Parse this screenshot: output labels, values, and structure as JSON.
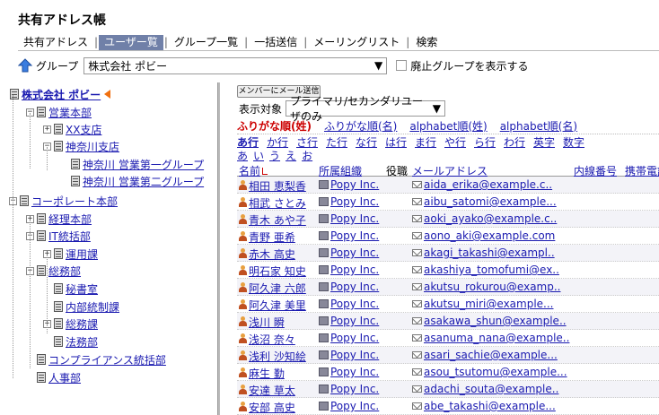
{
  "title": "共有アドレス帳",
  "tabs": [
    "共有アドレス",
    "ユーザー覧",
    "グループ一覧",
    "一括送信",
    "メーリングリスト",
    "検索"
  ],
  "active_tab": 1,
  "group_bar": {
    "label": "グループ",
    "selected": "株式会社 ポビー",
    "checkbox_label": "廃止グループを表示する"
  },
  "tree": [
    {
      "label": "株式会社 ポビー",
      "root": true
    },
    {
      "label": "営業本部",
      "toggle": "−"
    },
    {
      "label": "XX支店",
      "toggle": "+"
    },
    {
      "label": "神奈川支店",
      "toggle": "−"
    },
    {
      "label": "神奈川 営業第一グループ"
    },
    {
      "label": "神奈川 営業第二グループ"
    },
    {
      "label": "コーポレート本部",
      "toggle": "−"
    },
    {
      "label": "経理本部",
      "toggle": "+"
    },
    {
      "label": "IT統括部",
      "toggle": "−"
    },
    {
      "label": "運用課",
      "toggle": "+"
    },
    {
      "label": "総務部",
      "toggle": "−"
    },
    {
      "label": "秘書室"
    },
    {
      "label": "内部統制課"
    },
    {
      "label": "総務課",
      "toggle": "+"
    },
    {
      "label": "法務部"
    },
    {
      "label": "コンプライアンス統括部"
    },
    {
      "label": "人事部"
    }
  ],
  "right": {
    "mail_button": "メンバーにメール送信",
    "filter_label": "表示対象",
    "filter_value": "プライマリ/セカンダリユーザのみ",
    "sort_links": [
      "ふりがな順(姓)",
      "ふりがな順(名)",
      "alphabet順(姓)",
      "alphabet順(名)"
    ],
    "kana": [
      "あ行",
      "か行",
      "さ行",
      "た行",
      "な行",
      "は行",
      "ま行",
      "や行",
      "ら行",
      "わ行",
      "英字",
      "数字"
    ],
    "kana_sub": [
      "あ",
      "い",
      "う",
      "え",
      "お"
    ],
    "columns": {
      "name": "名前",
      "org": "所属組織",
      "title": "役職",
      "email": "メールアドレス",
      "ext": "内線番号",
      "mobile": "携帯電話"
    },
    "rows": [
      {
        "name": "相田 恵梨香",
        "org": "Popy Inc.",
        "email": "aida_erika@example.c.."
      },
      {
        "name": "相武 さとみ",
        "org": "Popy Inc.",
        "email": "aibu_satomi@example..."
      },
      {
        "name": "青木 あや子",
        "org": "Popy Inc.",
        "email": "aoki_ayako@example.c.."
      },
      {
        "name": "青野 亜希",
        "org": "Popy Inc.",
        "email": "aono_aki@example.com"
      },
      {
        "name": "赤木 高史",
        "org": "Popy Inc.",
        "email": "akagi_takashi@exampl.."
      },
      {
        "name": "明石家 知史",
        "org": "Popy Inc.",
        "email": "akashiya_tomofumi@ex.."
      },
      {
        "name": "阿久津 六郎",
        "org": "Popy Inc.",
        "email": "akutsu_rokurou@examp.."
      },
      {
        "name": "阿久津 美里",
        "org": "Popy Inc.",
        "email": "akutsu_miri@example..."
      },
      {
        "name": "浅川 瞬",
        "org": "Popy Inc.",
        "email": "asakawa_shun@example.."
      },
      {
        "name": "浅沼 奈々",
        "org": "Popy Inc.",
        "email": "asanuma_nana@example.."
      },
      {
        "name": "浅利 沙知絵",
        "org": "Popy Inc.",
        "email": "asari_sachie@example..."
      },
      {
        "name": "麻生 勤",
        "org": "Popy Inc.",
        "email": "asou_tsutomu@example..."
      },
      {
        "name": "安達 草太",
        "org": "Popy Inc.",
        "email": "adachi_souta@example.."
      },
      {
        "name": "安部 高史",
        "org": "Popy Inc.",
        "email": "abe_takashi@example..."
      }
    ]
  }
}
